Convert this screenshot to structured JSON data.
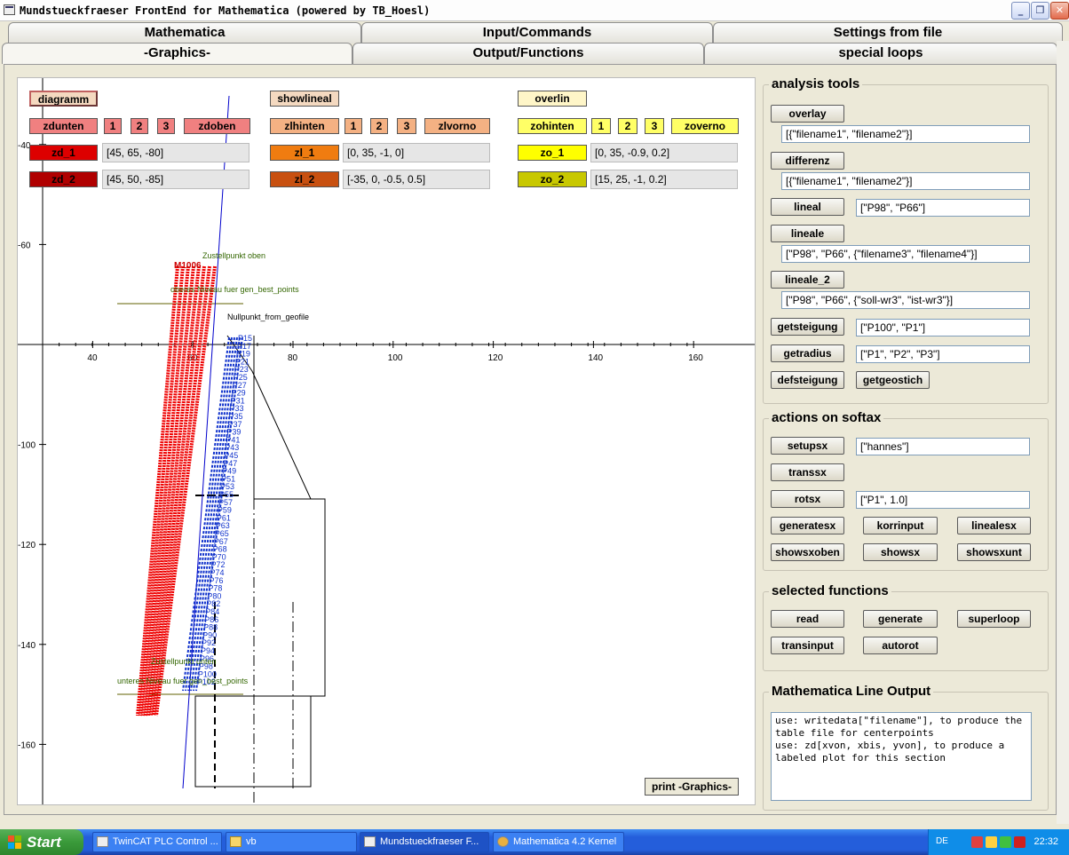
{
  "window": {
    "title": "Mundstueckfraeser FrontEnd for Mathematica (powered by TB_Hoesl)",
    "min_glyph": "_",
    "max_glyph": "❐",
    "close_glyph": "✕"
  },
  "tabs_row1": [
    "Mathematica",
    "Input/Commands",
    "Settings from file"
  ],
  "tabs_row2": [
    "-Graphics-",
    "Output/Functions",
    "special loops"
  ],
  "active_tab": "-Graphics-",
  "graphics": {
    "diagramm": "diagramm",
    "showlineal": "showlineal",
    "overlin": "overlin",
    "zd": {
      "unten": "zdunten",
      "n1": "1",
      "n2": "2",
      "n3": "3",
      "oben": "zdoben",
      "zd1": "zd_1",
      "zd1_val": "[45, 65, -80]",
      "zd2": "zd_2",
      "zd2_val": "[45, 50, -85]"
    },
    "zl": {
      "hinten": "zlhinten",
      "n1": "1",
      "n2": "2",
      "n3": "3",
      "vorno": "zlvorno",
      "zl1": "zl_1",
      "zl1_val": "[0, 35, -1, 0]",
      "zl2": "zl_2",
      "zl2_val": "[-35, 0, -0.5, 0.5]"
    },
    "zo": {
      "hinten": "zohinten",
      "n1": "1",
      "n2": "2",
      "n3": "3",
      "vorno": "zoverno",
      "zo1": "zo_1",
      "zo1_val": "[0, 35, -0.9, 0.2]",
      "zo2": "zo_2",
      "zo2_val": "[15, 25, -1, 0.2]"
    },
    "print": "print -Graphics-",
    "colors": {
      "zd_light": "#f08080",
      "zd1": "#dd0000",
      "zd2": "#b00000",
      "zl_light": "#f4b183",
      "zl1": "#f07c10",
      "zl2": "#c85010",
      "zo_light": "#ffff66",
      "zo1": "#ffff00",
      "zo2": "#c8c800",
      "plain": "#f4d9c0"
    }
  },
  "plot": {
    "x_ticks": [
      "40",
      "60",
      "80",
      "100",
      "120",
      "140",
      "160"
    ],
    "y_ticks": [
      "-40",
      "-60",
      "-100",
      "-120",
      "-140",
      "-160"
    ],
    "annotations": {
      "zustellpunkt_oben": "Zustellpunkt oben",
      "oberes_niveau": "oberes Niveau fuer gen_best_points",
      "nullpunkt": "Nullpunkt_from_geofile",
      "zustellpunkt_unten": "Zustellpunkt unten",
      "unteres_niveau": "unteres Niveau fuer gen_best_points",
      "red_cluster": "M1006"
    },
    "point_labels": [
      "P15",
      "P17",
      "P19",
      "P21",
      "P23",
      "P25",
      "P27",
      "P29",
      "P31",
      "P33",
      "P35",
      "P37",
      "P39",
      "P41",
      "P43",
      "P45",
      "P47",
      "P49",
      "P51",
      "P53",
      "P55",
      "P57",
      "P59",
      "P61",
      "P63",
      "P65",
      "P67",
      "P68",
      "P70",
      "P72",
      "P74",
      "P76",
      "P78",
      "P80",
      "P82",
      "P84",
      "P86",
      "P88",
      "P90",
      "P92",
      "P94",
      "P96",
      "P98",
      "P100",
      "P102"
    ]
  },
  "analysis": {
    "title": "analysis tools",
    "overlay": "overlay",
    "overlay_val": "[{\"filename1\", \"filename2\"}]",
    "differenz": "differenz",
    "differenz_val": "[{\"filename1\", \"filename2\"}]",
    "lineal": "lineal",
    "lineal_val": "[\"P98\", \"P66\"]",
    "lineale": "lineale",
    "lineale_val": "[\"P98\", \"P66\", {\"filename3\", \"filename4\"}]",
    "lineale_2": "lineale_2",
    "lineale_2_val": "[\"P98\", \"P66\", {\"soll-wr3\", \"ist-wr3\"}]",
    "getsteigung": "getsteigung",
    "getsteigung_val": "[\"P100\", \"P1\"]",
    "getradius": "getradius",
    "getradius_val": "[\"P1\", \"P2\", \"P3\"]",
    "defsteigung": "defsteigung",
    "getgeostich": "getgeostich"
  },
  "softax": {
    "title": "actions on softax",
    "setupsx": "setupsx",
    "setupsx_val": "[\"hannes\"]",
    "transsx": "transsx",
    "rotsx": "rotsx",
    "rotsx_val": "[\"P1\", 1.0]",
    "generatesx": "generatesx",
    "korrinput": "korrinput",
    "linealesx": "linealesx",
    "showsxoben": "showsxoben",
    "showsx": "showsx",
    "showsxunt": "showsxunt"
  },
  "functions": {
    "title": "selected functions",
    "read": "read",
    "generate": "generate",
    "superloop": "superloop",
    "transinput": "transinput",
    "autorot": "autorot"
  },
  "lineout": {
    "title": "Mathematica Line Output",
    "text": "use: writedata[\"filename\"], to produce the\ntable file for centerpoints\nuse: zd[xvon, xbis, yvon], to produce a\nlabeled plot for this section"
  },
  "taskbar": {
    "start": "Start",
    "items": [
      "TwinCAT PLC Control ...",
      "vb",
      "Mundstueckfraeser F...",
      "Mathematica 4.2 Kernel"
    ],
    "lang": "DE",
    "time": "22:32"
  }
}
